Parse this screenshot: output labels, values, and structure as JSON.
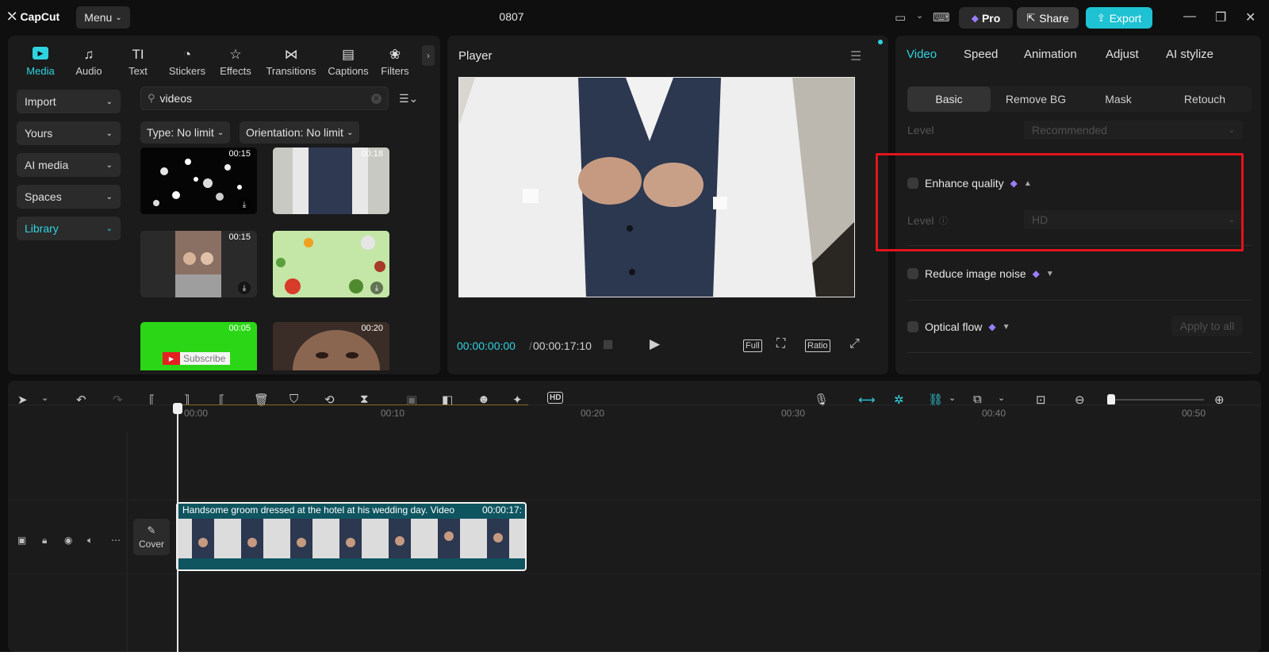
{
  "app": {
    "name": "CapCut",
    "menu_label": "Menu",
    "project_title": "0807"
  },
  "header": {
    "pro_label": "Pro",
    "share_label": "Share",
    "export_label": "Export"
  },
  "media_tabs": [
    {
      "label": "Media",
      "icon": "media-icon"
    },
    {
      "label": "Audio",
      "icon": "audio-icon"
    },
    {
      "label": "Text",
      "icon": "text-icon"
    },
    {
      "label": "Stickers",
      "icon": "sticker-icon"
    },
    {
      "label": "Effects",
      "icon": "effects-icon"
    },
    {
      "label": "Transitions",
      "icon": "transitions-icon"
    },
    {
      "label": "Captions",
      "icon": "captions-icon"
    },
    {
      "label": "Filters",
      "icon": "filters-icon"
    }
  ],
  "sidebar": {
    "items": [
      {
        "label": "Import"
      },
      {
        "label": "Yours"
      },
      {
        "label": "AI media"
      },
      {
        "label": "Spaces"
      },
      {
        "label": "Library"
      }
    ]
  },
  "search": {
    "value": "videos"
  },
  "filters": {
    "type": "Type: No limit",
    "orientation": "Orientation: No limit"
  },
  "thumbnails": [
    {
      "duration": "00:15"
    },
    {
      "duration": "00:18"
    },
    {
      "duration": "00:15"
    },
    {
      "duration": ""
    },
    {
      "duration": "00:05",
      "overlay": "Subscribe"
    },
    {
      "duration": "00:20"
    }
  ],
  "player": {
    "title": "Player",
    "current_time": "00:00:00:00",
    "total_time": "00:00:17:10",
    "full_label": "Full",
    "ratio_label": "Ratio"
  },
  "right_tabs": [
    "Video",
    "Speed",
    "Animation",
    "Adjust",
    "AI stylize"
  ],
  "sub_tabs": [
    "Basic",
    "Remove BG",
    "Mask",
    "Retouch"
  ],
  "settings": {
    "level_label": "Level",
    "level_top_value": "Recommended",
    "enhance_quality": "Enhance quality",
    "level_hd_value": "HD",
    "reduce_noise": "Reduce image noise",
    "optical_flow": "Optical flow",
    "apply_all": "Apply to all"
  },
  "timeline": {
    "ruler": [
      "00:00",
      "00:10",
      "00:20",
      "00:30",
      "00:40",
      "00:50"
    ],
    "cover_label": "Cover",
    "clip_title": "Handsome groom dressed at the hotel at his wedding day. Video",
    "clip_duration": "00:00:17:"
  },
  "colors": {
    "accent": "#1ec2d2",
    "highlight": "#e2141b",
    "pro_gem": "#9b7dff"
  }
}
